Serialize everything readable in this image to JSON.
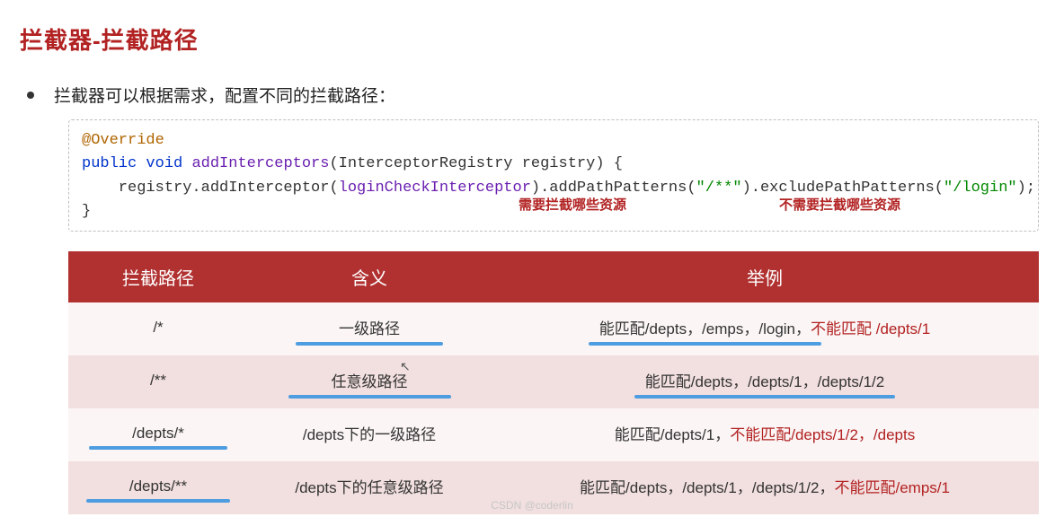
{
  "title": "拦截器-拦截路径",
  "bullet": "拦截器可以根据需求，配置不同的拦截路径：",
  "watermark": "",
  "footer": "CSDN @coderlin",
  "code": {
    "anno": "@Override",
    "kw_public": "public",
    "kw_void": "void",
    "fn": "addInterceptors",
    "param": "(InterceptorRegistry registry) {",
    "line_a": "    registry.addInterceptor(",
    "var": "loginCheckInterceptor",
    "line_b": ").addPathPatterns(",
    "str1": "\"/**\"",
    "line_c": ").excludePathPatterns(",
    "str2": "\"/login\"",
    "line_d": ");",
    "close": "}",
    "note1": "需要拦截哪些资源",
    "note2": "不需要拦截哪些资源"
  },
  "table": {
    "headers": [
      "拦截路径",
      "含义",
      "举例"
    ],
    "rows": [
      {
        "path": "/*",
        "meaning": "一级路径",
        "ex_pre": "能匹配/depts，/emps，/login，",
        "ex_red": "不能匹配 /depts/1",
        "ul_path": false,
        "ul_mean": true,
        "ul_ex": true
      },
      {
        "path": "/**",
        "meaning": "任意级路径",
        "ex_pre": "能匹配/depts，/depts/1，/depts/1/2",
        "ex_red": "",
        "ul_path": false,
        "ul_mean": true,
        "ul_ex": true
      },
      {
        "path": "/depts/*",
        "meaning": "/depts下的一级路径",
        "ex_pre": "能匹配/depts/1，",
        "ex_red": "不能匹配/depts/1/2，/depts",
        "ul_path": true,
        "ul_mean": false,
        "ul_ex": false
      },
      {
        "path": "/depts/**",
        "meaning": "/depts下的任意级路径",
        "ex_pre": "能匹配/depts，/depts/1，/depts/1/2，",
        "ex_red": "不能匹配/emps/1",
        "ul_path": true,
        "ul_mean": false,
        "ul_ex": false
      }
    ]
  }
}
